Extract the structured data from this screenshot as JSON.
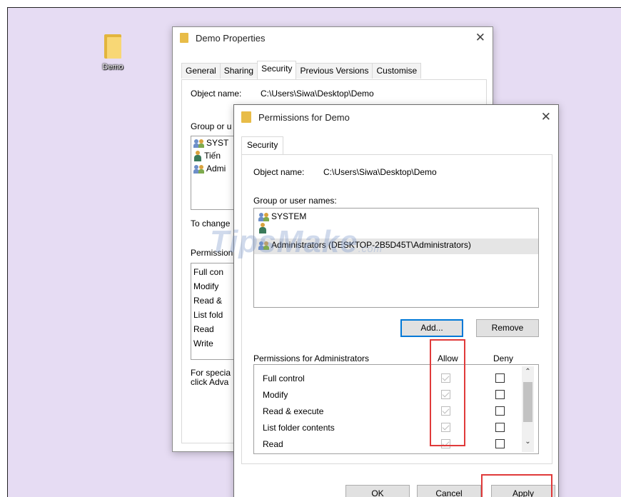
{
  "desktop": {
    "icon_label": "Demo"
  },
  "props": {
    "title": "Demo Properties",
    "tabs": [
      "General",
      "Sharing",
      "Security",
      "Previous Versions",
      "Customise"
    ],
    "object_label": "Object name:",
    "object_value": "C:\\Users\\Siwa\\Desktop\\Demo",
    "group_label": "Group or u",
    "users": [
      "SYST",
      "Tiến",
      "Admi"
    ],
    "change_text": "To change",
    "perm_label": "Permission",
    "perms": [
      "Full con",
      "Modify",
      "Read &",
      "List fold",
      "Read",
      "Write"
    ],
    "special_1": "For specia",
    "special_2": "click Adva"
  },
  "perm_dialog": {
    "title": "Permissions for Demo",
    "close_glyph": "✕",
    "tab": "Security",
    "object_label": "Object name:",
    "object_value": "C:\\Users\\Siwa\\Desktop\\Demo",
    "group_label": "Group or user names:",
    "users": [
      "SYSTEM",
      "",
      "Administrators (DESKTOP-2B5D45T\\Administrators)"
    ],
    "add_label": "Add...",
    "remove_label": "Remove",
    "perm_header": "Permissions for Administrators",
    "allow_header": "Allow",
    "deny_header": "Deny",
    "perms": [
      "Full control",
      "Modify",
      "Read & execute",
      "List folder contents",
      "Read"
    ],
    "ok_label": "OK",
    "cancel_label": "Cancel",
    "apply_label": "Apply"
  },
  "watermark": {
    "text": "TipsMake",
    "domain": ".com"
  },
  "colors": {
    "desktop": "#e6dcf3",
    "highlight": "#e03a3a",
    "focus": "#0078d7"
  }
}
